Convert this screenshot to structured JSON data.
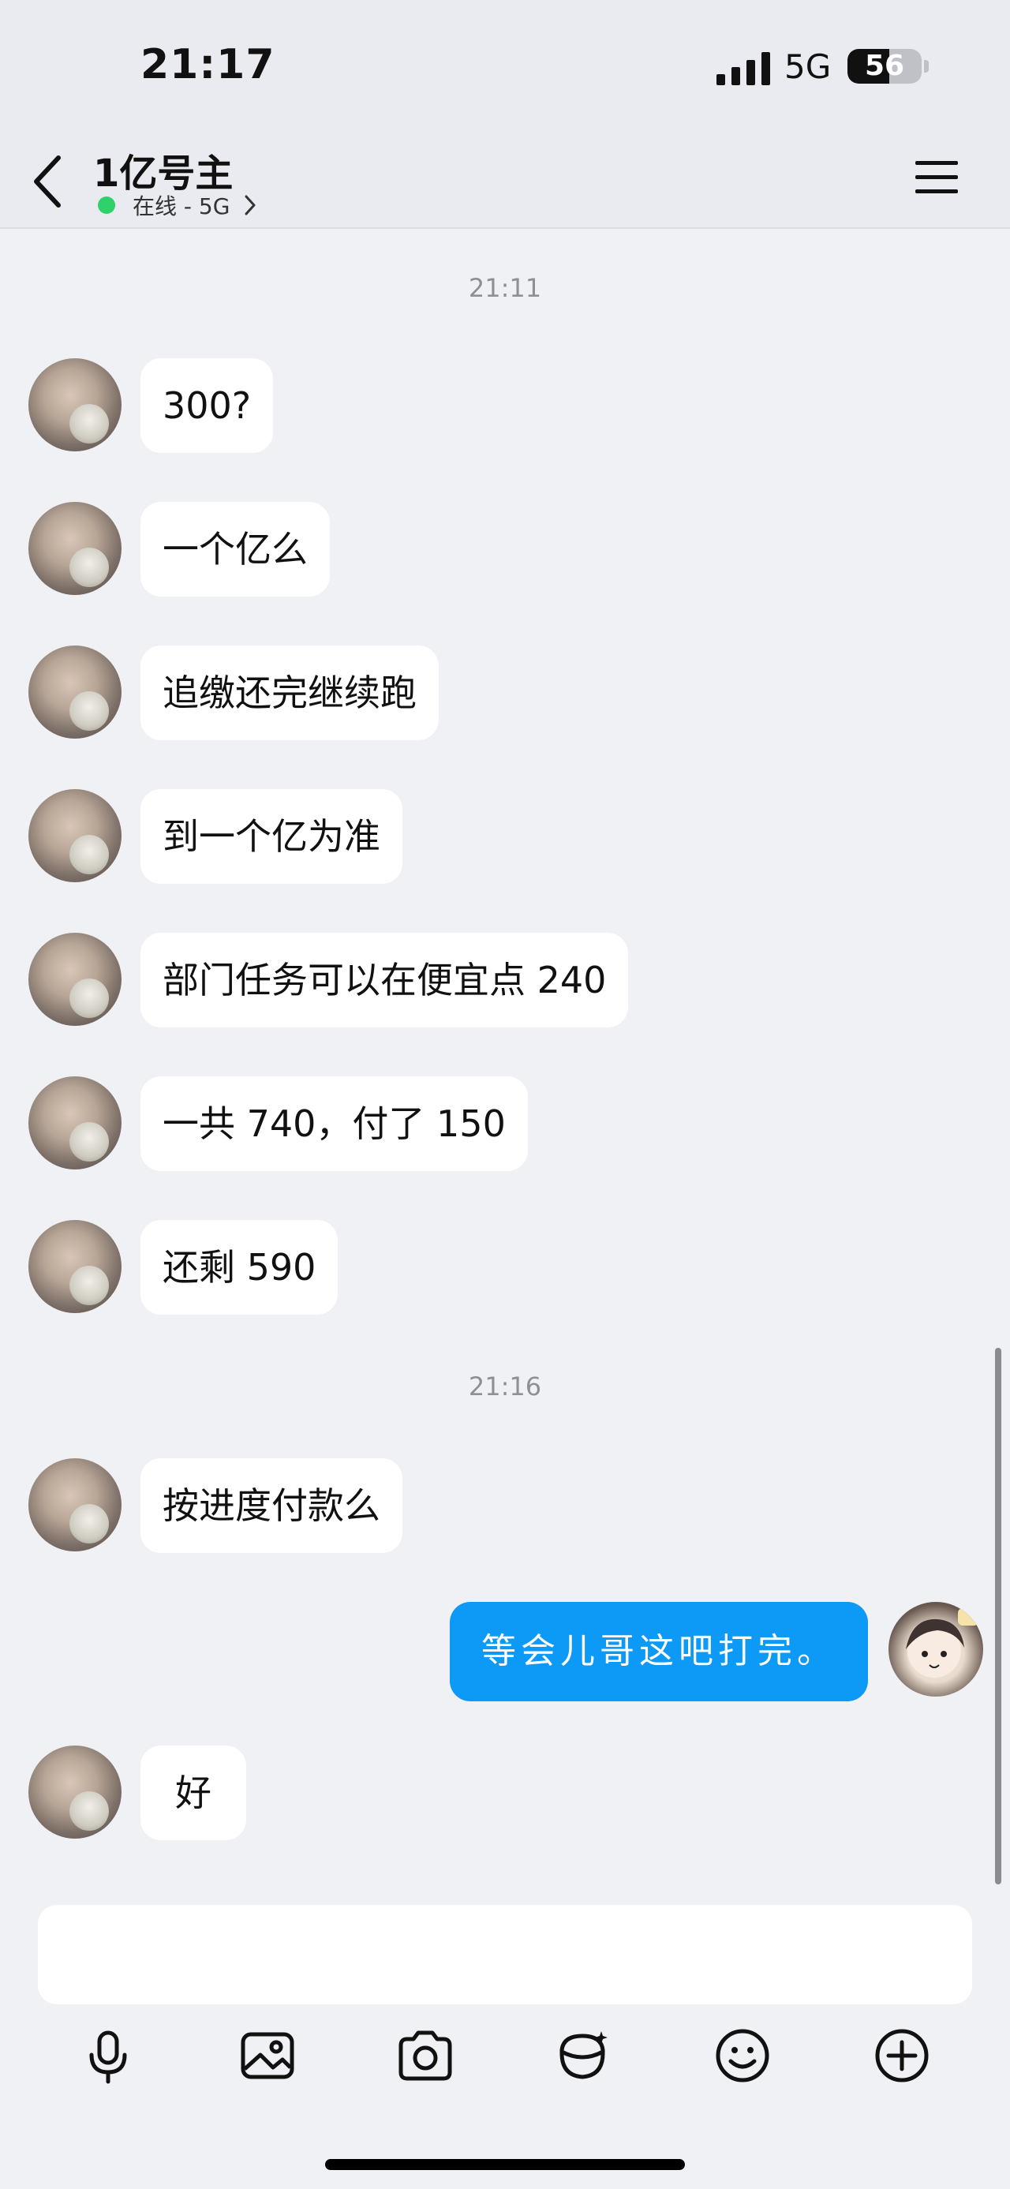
{
  "status_bar": {
    "time": "21:17",
    "network": "5G",
    "battery_level": 56,
    "battery_text": "56"
  },
  "header": {
    "title": "1亿号主",
    "status": "在线 - 5G",
    "status_color": "#2ed16a"
  },
  "messages": {
    "time_1": "21:11",
    "m1": "300?",
    "m2": "一个亿么",
    "m3": "追缴还完继续跑",
    "m4": "到一个亿为准",
    "m5": "部门任务可以在便宜点 240",
    "m6": "一共 740，付了 150",
    "m7": "还剩 590",
    "time_2": "21:16",
    "m8": "按进度付款么",
    "self_1": "等会儿哥这吧打完。",
    "m9": "好"
  },
  "colors": {
    "self_bubble": "#0d99f6",
    "other_bubble": "#ffffff",
    "background": "#f0f1f5"
  },
  "toolbar": {
    "icons": [
      "microphone-icon",
      "image-icon",
      "camera-icon",
      "red-packet-icon",
      "emoji-icon",
      "plus-icon"
    ]
  }
}
